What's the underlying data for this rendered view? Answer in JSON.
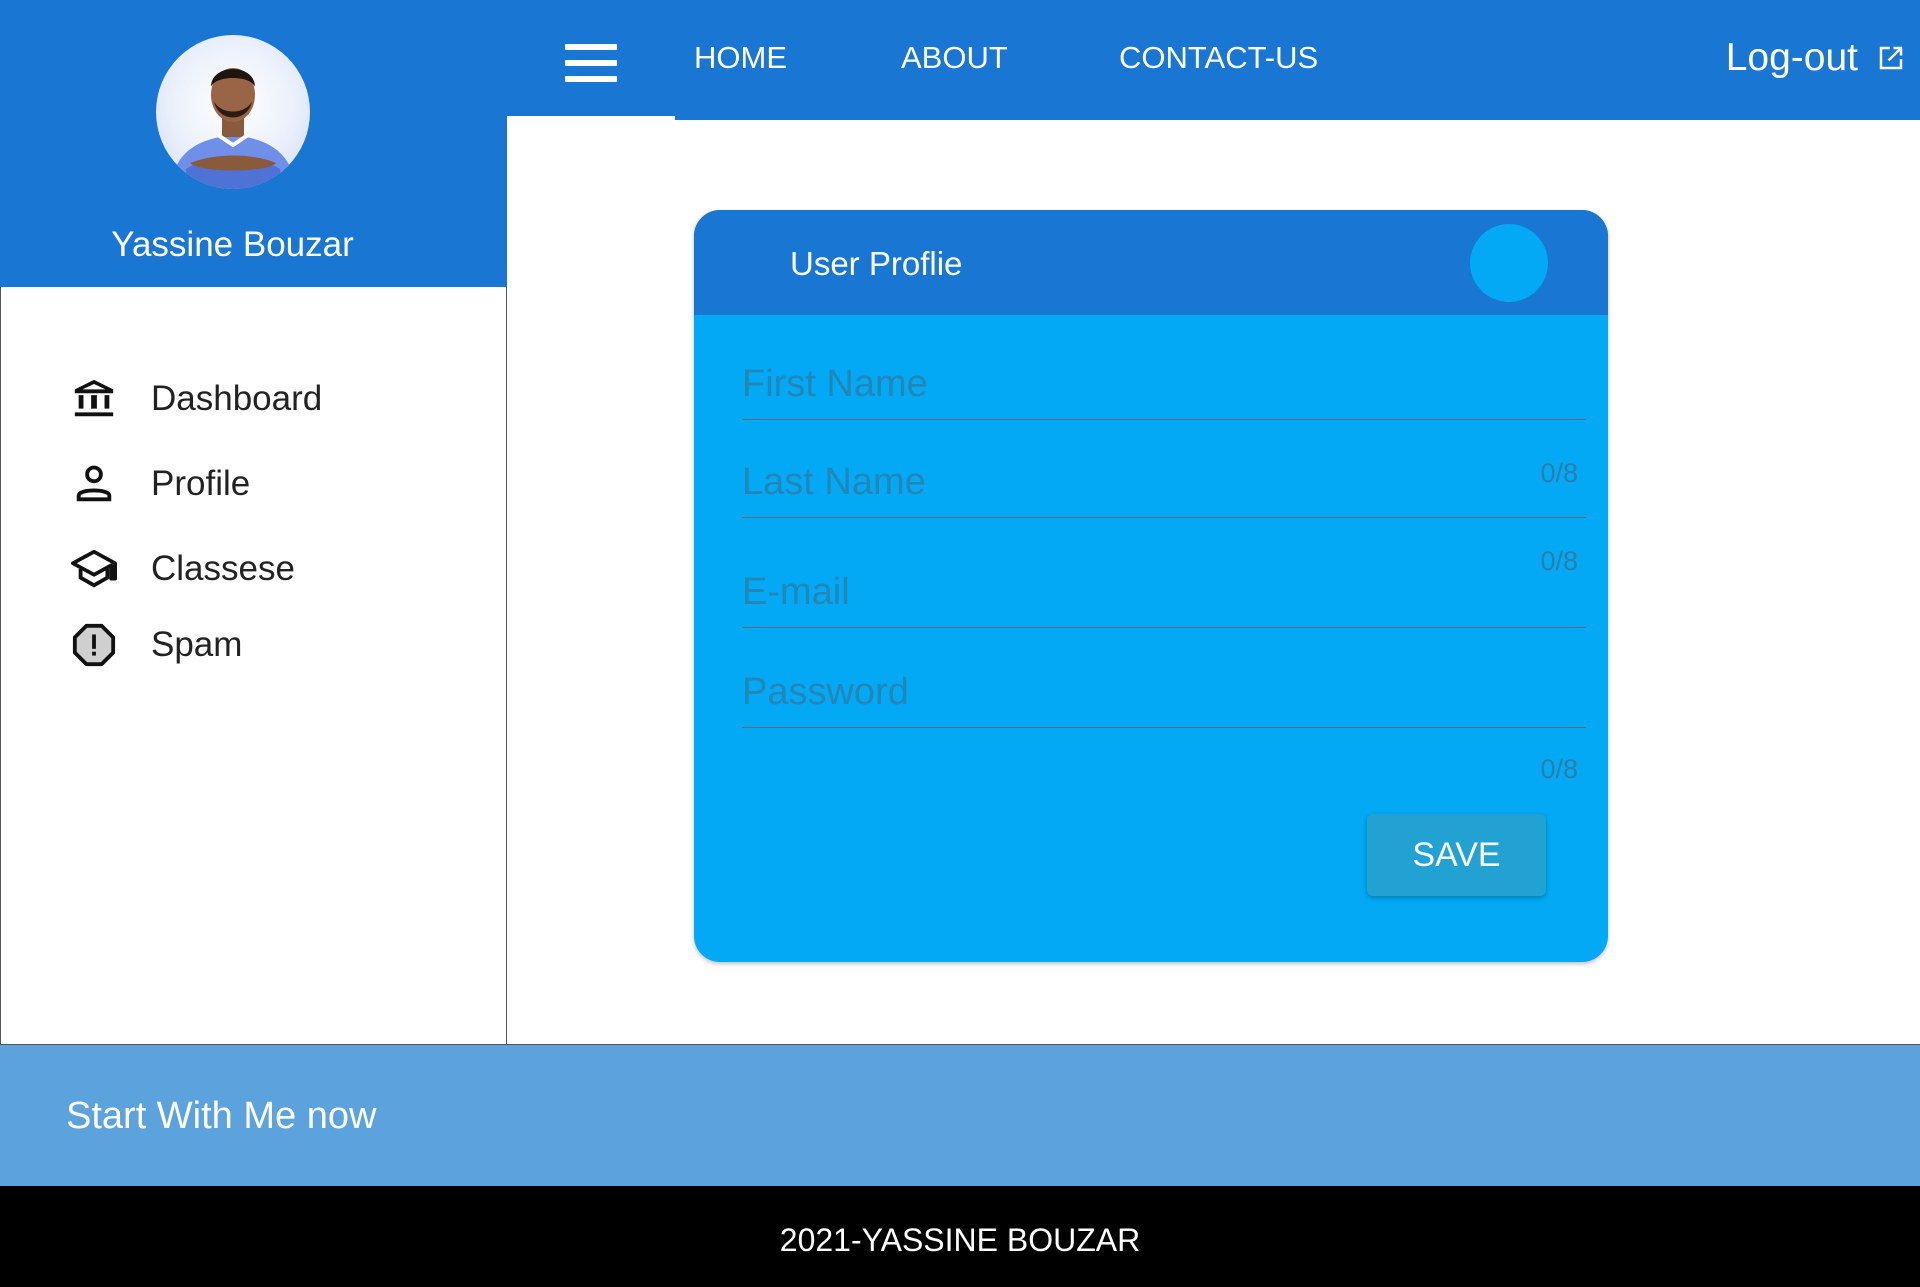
{
  "sidebar": {
    "user_name": "Yassine Bouzar",
    "items": [
      {
        "label": "Dashboard",
        "icon": "bank-icon"
      },
      {
        "label": "Profile",
        "icon": "person-icon"
      },
      {
        "label": "Classese",
        "icon": "school-cap-icon"
      },
      {
        "label": "Spam",
        "icon": "alert-octagon-icon"
      }
    ]
  },
  "topbar": {
    "menu_icon": "hamburger-menu-icon",
    "nav": [
      "HOME",
      "ABOUT",
      "CONTACT-US"
    ],
    "logout_label": "Log-out",
    "logout_icon": "open-in-new-icon"
  },
  "profile_card": {
    "title": "User Proflie",
    "fields": [
      {
        "placeholder": "First Name",
        "value": "",
        "counter": "0/8"
      },
      {
        "placeholder": "Last Name",
        "value": "",
        "counter": "0/8"
      },
      {
        "placeholder": "E-mail",
        "value": ""
      },
      {
        "placeholder": "Password",
        "value": "",
        "counter": "0/8"
      }
    ],
    "save_label": "SAVE"
  },
  "footer": {
    "banner_text": "Start With Me now",
    "copyright": "2021-YASSINE BOUZAR"
  },
  "colors": {
    "primary": "#1976d2",
    "card": "#03a9f4",
    "banner": "#5ca3de",
    "footer": "#000000"
  }
}
